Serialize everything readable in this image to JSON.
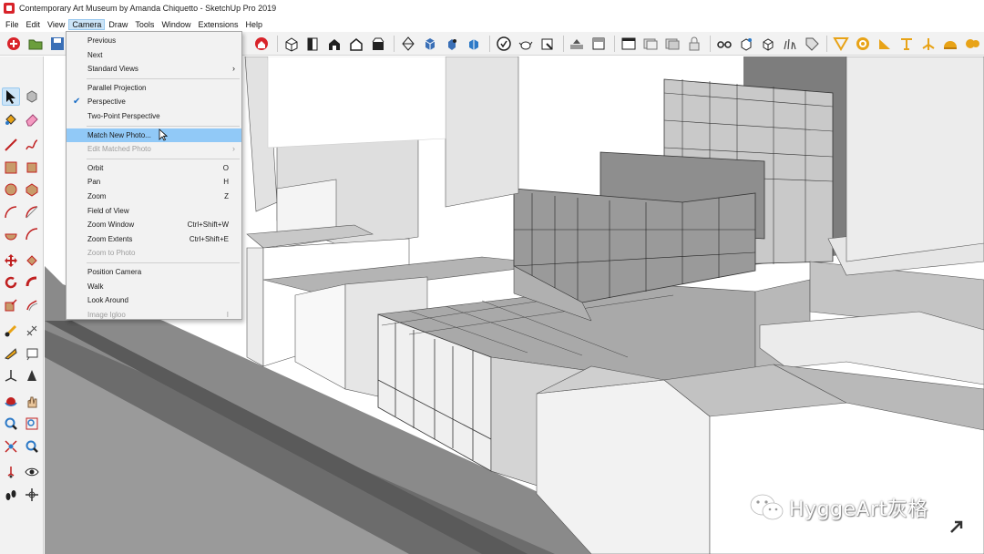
{
  "window": {
    "title": "Contemporary Art Museum by Amanda Chiquetto - SketchUp Pro 2019"
  },
  "menubar": {
    "items": [
      "File",
      "Edit",
      "View",
      "Camera",
      "Draw",
      "Tools",
      "Window",
      "Extensions",
      "Help"
    ],
    "active": "Camera"
  },
  "camera_menu": {
    "previous": "Previous",
    "next": "Next",
    "standard_views": "Standard Views",
    "parallel_projection": "Parallel Projection",
    "perspective": "Perspective",
    "perspective_checked": true,
    "two_point_perspective": "Two-Point Perspective",
    "match_new_photo": "Match New Photo...",
    "edit_matched_photo": "Edit Matched Photo",
    "orbit": "Orbit",
    "orbit_shortcut": "O",
    "pan": "Pan",
    "pan_shortcut": "H",
    "zoom": "Zoom",
    "zoom_shortcut": "Z",
    "field_of_view": "Field of View",
    "zoom_window": "Zoom Window",
    "zoom_window_shortcut": "Ctrl+Shift+W",
    "zoom_extents": "Zoom Extents",
    "zoom_extents_shortcut": "Ctrl+Shift+E",
    "zoom_to_photo": "Zoom to Photo",
    "position_camera": "Position Camera",
    "walk": "Walk",
    "look_around": "Look Around",
    "image_igloo": "Image Igloo",
    "image_igloo_shortcut": "I",
    "hovered_item": "Match New Photo..."
  },
  "watermark": {
    "text": "HyggeArt灰格"
  },
  "colors": {
    "menu_highlight": "#91c9f7",
    "active_menu_bg": "#cce4f7",
    "toolbar_bg": "#f2f2f2",
    "app_red": "#d8232a",
    "icon_gold": "#e8a317"
  },
  "icons": {
    "toolbar": [
      "new-icon",
      "open-icon",
      "save-icon",
      "warehouse-icon",
      "iso-view-icon",
      "top-view-icon",
      "front-view-icon",
      "right-view-icon",
      "back-view-icon",
      "left-view-icon",
      "section-plane-icon",
      "component-cube-icon",
      "solid-tools-icon",
      "intersect-icon",
      "trimble-connect-icon",
      "teapot-icon",
      "extension-icon",
      "sandbox-icon",
      "shadows-icon",
      "fog-icon",
      "lock-icon",
      "glasses-icon",
      "section-fill-icon",
      "box-icon",
      "grass-icon",
      "tag-icon",
      "protractor-icon",
      "text-icon",
      "axes-icon",
      "dimension-icon"
    ],
    "palette": [
      "select-icon",
      "component-icon",
      "paint-bucket-icon",
      "eraser-icon",
      "line-icon",
      "freehand-icon",
      "rectangle-icon",
      "rotated-rectangle-icon",
      "circle-icon",
      "polygon-icon",
      "arc-icon",
      "two-point-arc-icon",
      "pie-icon",
      "three-point-arc-icon",
      "move-icon",
      "push-pull-icon",
      "rotate-icon",
      "follow-me-icon",
      "scale-icon",
      "offset-icon",
      "tape-measure-icon",
      "text-icon",
      "protractor-icon",
      "3d-text-icon",
      "axes-icon",
      "dimension-icon",
      "orbit-icon",
      "pan-icon",
      "zoom-icon",
      "zoom-window-icon",
      "zoom-extents-icon",
      "previous-view-icon",
      "position-camera-icon",
      "look-around-icon",
      "walk-icon",
      "section-plane-icon"
    ]
  }
}
